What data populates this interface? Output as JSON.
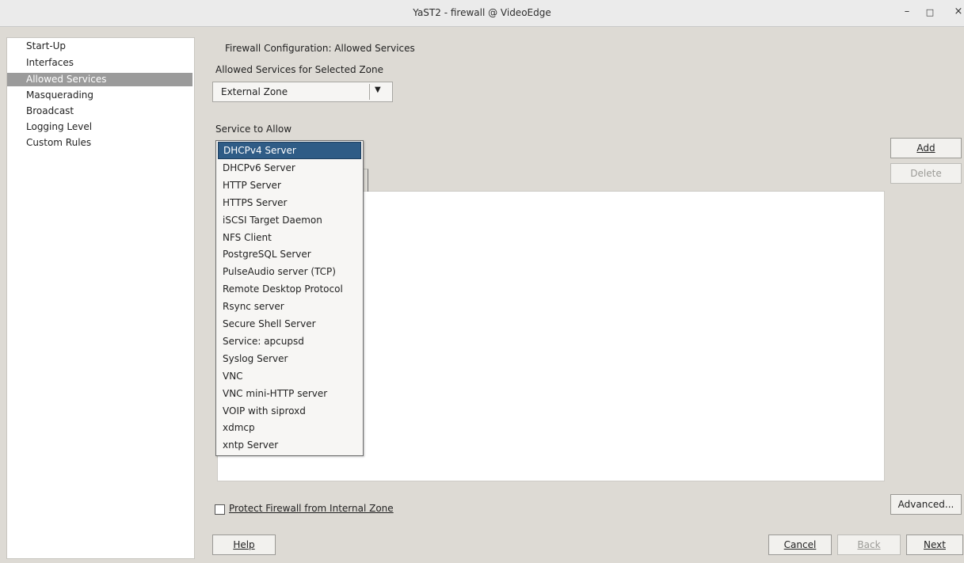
{
  "window": {
    "title": "YaST2 - firewall @ VideoEdge",
    "minimize": "–",
    "maximize": "□",
    "close": "×"
  },
  "sidebar": {
    "items": [
      {
        "label": "Start-Up",
        "selected": false
      },
      {
        "label": "Interfaces",
        "selected": false
      },
      {
        "label": "Allowed Services",
        "selected": true
      },
      {
        "label": "Masquerading",
        "selected": false
      },
      {
        "label": "Broadcast",
        "selected": false
      },
      {
        "label": "Logging Level",
        "selected": false
      },
      {
        "label": "Custom Rules",
        "selected": false
      }
    ]
  },
  "main": {
    "heading": "Firewall Configuration: Allowed Services",
    "zone_label": "Allowed Services for Selected Zone",
    "zone_value": "External Zone",
    "zone_arrow": "▼",
    "service_label": "Service to Allow",
    "protect_label": "Protect Firewall from Internal Zone",
    "protect_checked": false
  },
  "dropdown": {
    "selected_index": 0,
    "options": [
      "DHCPv4 Server",
      "DHCPv6 Server",
      "HTTP Server",
      "HTTPS Server",
      "iSCSI Target Daemon",
      "NFS Client",
      "PostgreSQL Server",
      "PulseAudio server (TCP)",
      "Remote Desktop Protocol",
      "Rsync server",
      "Secure Shell Server",
      "Service: apcupsd",
      "Syslog Server",
      "VNC",
      "VNC mini-HTTP server",
      "VOIP with siproxd",
      "xdmcp",
      "xntp Server"
    ]
  },
  "buttons": {
    "add": "Add",
    "delete": "Delete",
    "advanced": "Advanced...",
    "help": "Help",
    "cancel": "Cancel",
    "back": "Back",
    "next": "Next"
  },
  "colors": {
    "selection": "#2f5c86",
    "sidebar_selection": "#9b9b9b",
    "background": "#dddad4"
  }
}
